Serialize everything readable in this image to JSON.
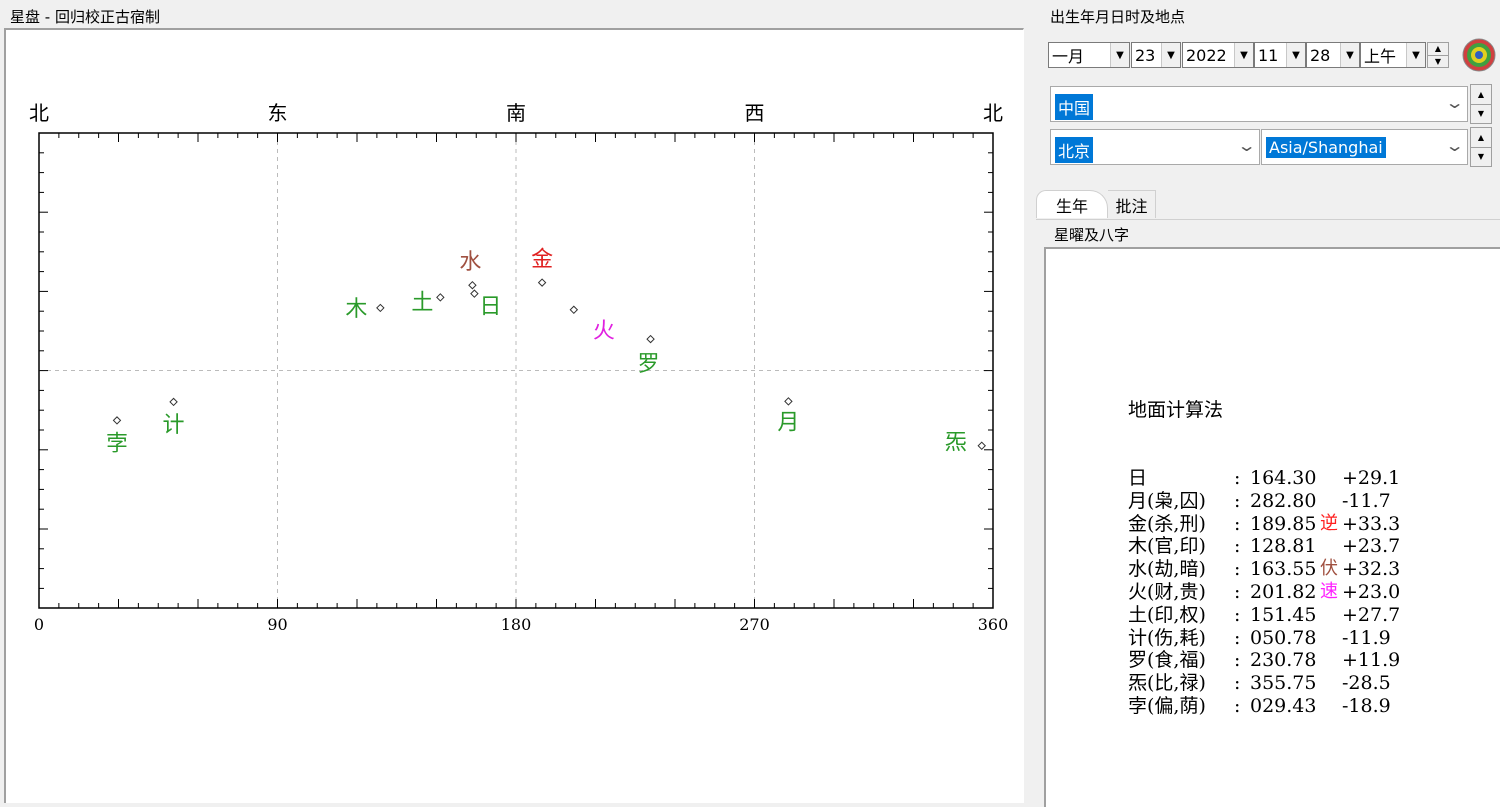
{
  "chart_group": {
    "title": "星盘 - 回归校正古宿制"
  },
  "chart_data": {
    "type": "scatter",
    "x_range": [
      0,
      360
    ],
    "x_ticks": [
      "0",
      "90",
      "180",
      "270",
      "360"
    ],
    "top_labels": [
      "北",
      "东",
      "南",
      "西",
      "北"
    ],
    "grid": true,
    "points": [
      {
        "name": "日",
        "x": 164.3,
        "y": 29.1,
        "color": "#2a9a2a"
      },
      {
        "name": "月",
        "x": 282.8,
        "y": -11.7,
        "color": "#2a9a2a"
      },
      {
        "name": "金",
        "x": 189.85,
        "y": 33.3,
        "color": "#e02020"
      },
      {
        "name": "木",
        "x": 128.81,
        "y": 23.7,
        "color": "#2a9a2a"
      },
      {
        "name": "水",
        "x": 163.55,
        "y": 32.3,
        "color": "#a05040"
      },
      {
        "name": "火",
        "x": 201.82,
        "y": 23.0,
        "color": "#e020e0"
      },
      {
        "name": "土",
        "x": 151.45,
        "y": 27.7,
        "color": "#2a9a2a"
      },
      {
        "name": "计",
        "x": 50.78,
        "y": -11.9,
        "color": "#2a9a2a"
      },
      {
        "name": "罗",
        "x": 230.78,
        "y": 11.9,
        "color": "#2a9a2a"
      },
      {
        "name": "炁",
        "x": 355.75,
        "y": -28.5,
        "color": "#2a9a2a"
      },
      {
        "name": "孛",
        "x": 29.43,
        "y": -18.9,
        "color": "#2a9a2a"
      }
    ]
  },
  "birth_group": {
    "title": "出生年月日时及地点",
    "month": "一月",
    "day": "23",
    "year": "2022",
    "hour": "11",
    "minute": "28",
    "ampm": "上午",
    "country": "中国",
    "city": "北京",
    "timezone": "Asia/Shanghai"
  },
  "tabs": {
    "birth": "生年",
    "notes": "批注"
  },
  "info": {
    "title": "星曜及八字",
    "heading": "地面计算法",
    "rows": [
      {
        "name": "日",
        "deg": "164.30",
        "mark": "",
        "mark_color": "",
        "lat": "+29.1"
      },
      {
        "name": "月(枭,囚)",
        "deg": "282.80",
        "mark": "",
        "mark_color": "",
        "lat": "-11.7"
      },
      {
        "name": "金(杀,刑)",
        "deg": "189.85",
        "mark": "逆",
        "mark_color": "#ff2020",
        "lat": "+33.3"
      },
      {
        "name": "木(官,印)",
        "deg": "128.81",
        "mark": "",
        "mark_color": "",
        "lat": "+23.7"
      },
      {
        "name": "水(劫,暗)",
        "deg": "163.55",
        "mark": "伏",
        "mark_color": "#a05040",
        "lat": "+32.3"
      },
      {
        "name": "火(财,贵)",
        "deg": "201.82",
        "mark": "速",
        "mark_color": "#ff20ff",
        "lat": "+23.0"
      },
      {
        "name": "土(印,权)",
        "deg": "151.45",
        "mark": "",
        "mark_color": "",
        "lat": "+27.7"
      },
      {
        "name": "计(伤,耗)",
        "deg": "050.78",
        "mark": "",
        "mark_color": "",
        "lat": "-11.9"
      },
      {
        "name": "罗(食,福)",
        "deg": "230.78",
        "mark": "",
        "mark_color": "",
        "lat": "+11.9"
      },
      {
        "name": "炁(比,禄)",
        "deg": "355.75",
        "mark": "",
        "mark_color": "",
        "lat": "-28.5"
      },
      {
        "name": "孛(偏,荫)",
        "deg": "029.43",
        "mark": "",
        "mark_color": "",
        "lat": "-18.9"
      }
    ]
  }
}
